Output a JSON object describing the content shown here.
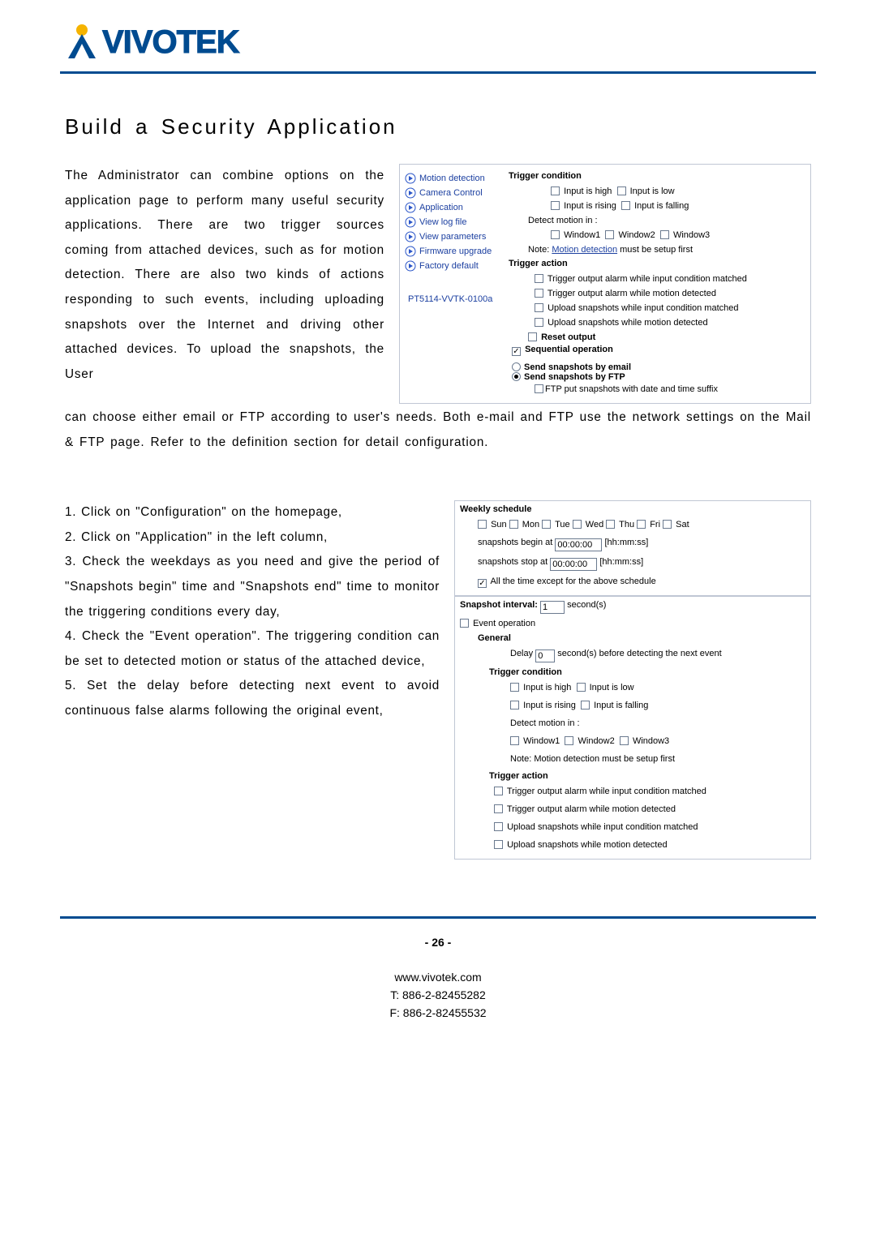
{
  "logo": {
    "text": "VIVOTEK"
  },
  "title": "Build a Security Application",
  "para1": "The Administrator can combine options on the application page to perform many useful security applications. There are two trigger sources coming from attached devices, such as for motion detection. There are also two kinds of actions responding to such events, including uploading snapshots over the Internet and driving other attached devices. To upload the snapshots, the User",
  "para2": "can choose either email or FTP according to user's needs. Both e-mail and FTP use the network settings on the Mail & FTP page. Refer to the definition section for detail configuration.",
  "nav": {
    "items": [
      "Motion detection",
      "Camera Control",
      "Application",
      "View log file",
      "View parameters",
      "Firmware upgrade",
      "Factory default"
    ],
    "model": "PT5114-VVTK-0100a"
  },
  "panel1": {
    "trigger_condition": "Trigger condition",
    "tc": {
      "input_high": "Input is high",
      "input_low": "Input is low",
      "input_rising": "Input is rising",
      "input_falling": "Input is falling",
      "detect_motion": "Detect motion in :",
      "win1": "Window1",
      "win2": "Window2",
      "win3": "Window3",
      "note_pre": "Note: ",
      "note_link": "Motion detection",
      "note_post": " must be setup first"
    },
    "trigger_action": "Trigger action",
    "ta": {
      "a1": "Trigger output alarm while input condition matched",
      "a2": "Trigger output alarm while motion detected",
      "a3": "Upload snapshots while input condition matched",
      "a4": "Upload snapshots while motion detected",
      "reset": "Reset output"
    },
    "seq": "Sequential operation",
    "email": "Send snapshots by email",
    "ftp": "Send snapshots by FTP",
    "ftp_opt": "FTP put snapshots with date and time suffix"
  },
  "steps": {
    "s1a": "1. Click on \"Configuration\" on the homepage,",
    "s2": "2. Click on \"Application\" in the left column,",
    "s3": "3. Check the weekdays as you need and give the period of \"Snapshots begin\" time and \"Snapshots end\" time to monitor the triggering conditions every day,",
    "s4": "4. Check the \"Event operation\". The triggering condition can be set to detected motion or status of the attached device,",
    "s5": "5. Set the delay before detecting next event to avoid continuous false alarms following the original event,"
  },
  "panel2": {
    "weekly": "Weekly schedule",
    "days": [
      "Sun",
      "Mon",
      "Tue",
      "Wed",
      "Thu",
      "Fri",
      "Sat"
    ],
    "snap_begin_pre": "snapshots begin at ",
    "snap_begin_val": "00:00:00",
    "hhmmss": "[hh:mm:ss]",
    "snap_stop_pre": "snapshots stop at ",
    "snap_stop_val": "00:00:00",
    "all_time": "All the time except for the above schedule",
    "snap_int_lbl": "Snapshot interval:",
    "snap_int_val": "1",
    "snap_int_unit": "second(s)",
    "event_op": "Event operation",
    "general": "General",
    "delay_lbl": "Delay",
    "delay_val": "0",
    "delay_post": "second(s) before detecting the next event",
    "tc_hdr": "Trigger condition",
    "ta_hdr": "Trigger action"
  },
  "footer": {
    "page": "- 26 -",
    "url": "www.vivotek.com",
    "tel": "T: 886-2-82455282",
    "fax": "F: 886-2-82455532"
  }
}
